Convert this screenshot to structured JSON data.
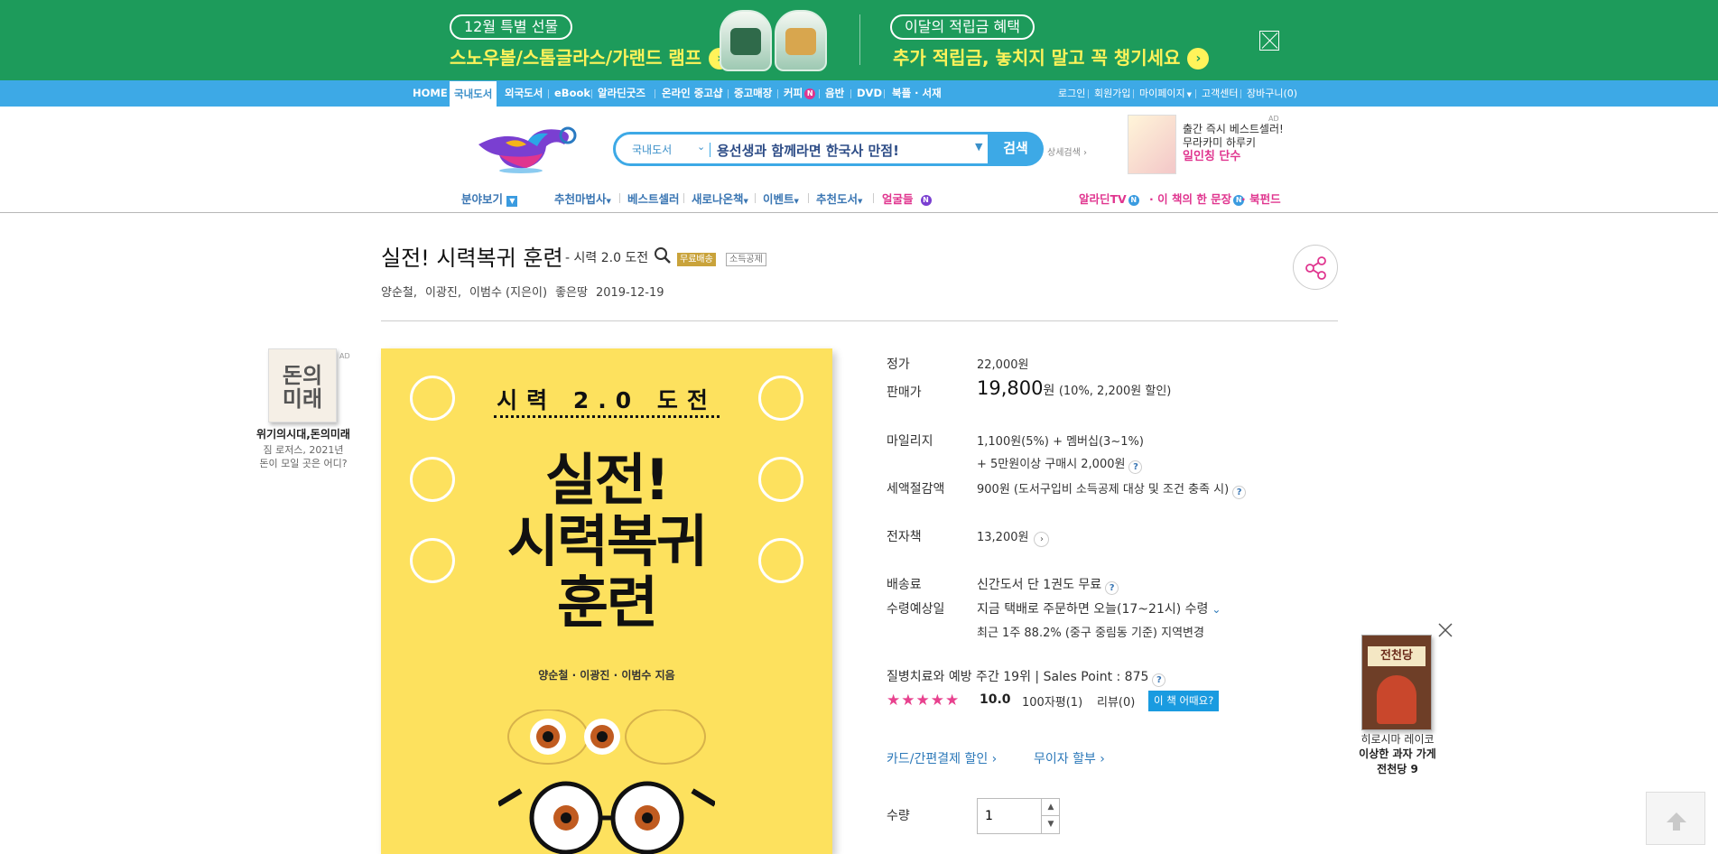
{
  "promo": {
    "left_pill": "12월 특별 선물",
    "left_line": "스노우볼/스톰글라스/가랜드 램프",
    "right_pill": "이달의 적립금 혜택",
    "right_line": "추가 적립금, 놓치지 말고 꼭 챙기세요",
    "arrow_icon": "chevron-right-icon",
    "close_icon": "close-icon",
    "colors": {
      "bg": "#1d9b5b",
      "accent": "#fff35a"
    }
  },
  "topnav": {
    "left": [
      "HOME",
      "국내도서",
      "외국도서",
      "eBook",
      "알라딘굿즈",
      "온라인 중고샵",
      "중고매장",
      "커피",
      "음반",
      "DVD",
      "북플 · 서재"
    ],
    "new_badge": "N",
    "right": [
      "로그인",
      "회원가입",
      "마이페이지",
      "고객센터",
      "장바구니(0)"
    ],
    "color": "#3da9e6"
  },
  "search": {
    "category": "국내도서",
    "value": "용선생과 함께라면 한국사 만점!",
    "button": "검색",
    "detail": "상세검색"
  },
  "ad_top": {
    "tag": "AD",
    "line1": "출간 즉시 베스트셀러!",
    "line2": "무라카미 하루키",
    "line3": "일인칭 단수"
  },
  "catnav": {
    "browse": "분야보기",
    "items": [
      "추천마법사",
      "베스트셀러",
      "새로나온책",
      "이벤트",
      "추천도서",
      "얼굴들"
    ],
    "right": [
      "알라딘TV",
      "이 책의 한 문장",
      "북펀드"
    ],
    "n_badge": "N"
  },
  "product": {
    "title": "실전! 시력복귀 훈련",
    "subtitle": "- 시력 2.0 도전",
    "tag_free": "무료배송",
    "tag_tax": "소득공제",
    "authors": [
      "양순철,",
      "이광진,",
      "이범수 (지은이)",
      "좋은땅",
      "2019-12-19"
    ],
    "share_icon": "share-icon"
  },
  "cover": {
    "series": "시력 2.0 도전",
    "line1": "실전!",
    "line2": "시력복귀",
    "line3": "훈련",
    "authors": "양순철 · 이광진 · 이범수 지음"
  },
  "left_ad": {
    "tag": "AD",
    "cover_text": "돈의미래",
    "title": "위기의시대,돈의미래",
    "desc1": "짐 로저스, 2021년",
    "desc2": "돈이 모일 곳은 어디?"
  },
  "info": {
    "list_label": "정가",
    "list_price": "22,000원",
    "sale_label": "판매가",
    "sale_price": "19,800",
    "sale_unit": "원",
    "sale_discount": "(10%, 2,200원 할인)",
    "mileage_label": "마일리지",
    "mileage_line1": "1,100원(5%) +  멤버십(3~1%)",
    "mileage_line2": "+ 5만원이상 구매시 2,000원",
    "tax_label": "세액절감액",
    "tax_value": "900원 (도서구입비 소득공제 대상 및 조건 충족 시)",
    "ebook_label": "전자책",
    "ebook_value": "13,200원",
    "ship_label": "배송료",
    "ship_value": "신간도서 단 1권도 무료",
    "recv_label": "수령예상일",
    "recv_line1": "지금 택배로 주문하면 오늘(17~21시) 수령",
    "recv_line2": "최근 1주 88.2% (중구 중림동 기준) 지역변경",
    "rank_line": "질병치료와 예방 주간 19위  |  Sales Point : 875",
    "rating_stars": "★★★★★",
    "rating": 10.0,
    "rating_score": "10.0",
    "rating_100": "100자평(1)",
    "review_count": "리뷰(0)",
    "how_button": "이 책 어때요?",
    "card_discount": "카드/간편결제 할인",
    "installment": "무이자 할부",
    "qty_label": "수량",
    "qty_value": "1",
    "q": "?",
    "chev": "›"
  },
  "floating": {
    "cover_text": "전천당",
    "cap1": "히로시마 레이코",
    "cap2": "이상한 과자 가게",
    "cap3": "전천당 9"
  }
}
